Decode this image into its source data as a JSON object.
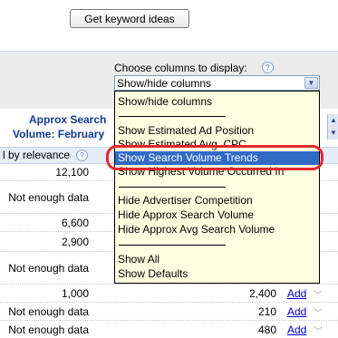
{
  "toolbar": {
    "get_ideas_label": "Get keyword ideas"
  },
  "columns_chooser": {
    "label": "Choose columns to display:",
    "help_icon": "?",
    "selected": "Show/hide columns",
    "arrow": "▼",
    "options": [
      "Show/hide columns",
      "Show Estimated Ad Position",
      "Show Estimated Avg. CPC",
      "Show Search Volume Trends",
      "Show Highest Volume Occurred In",
      "Hide Advertiser Competition",
      "Hide Approx Search Volume",
      "Hide Approx Avg Search Volume",
      "Show All",
      "Show Defaults"
    ],
    "highlighted_option": "Show Search Volume Trends"
  },
  "table": {
    "header_line1": "Approx Search",
    "header_line2": "Volume: February",
    "sort_label": "l by relevance",
    "sort_help": "?",
    "scroll_up": "▲",
    "scroll_down": "▼",
    "rows": [
      {
        "volume": "12,100",
        "volume2": "",
        "add": ""
      },
      {
        "volume": "Not enough data",
        "volume2": "",
        "add": ""
      },
      {
        "volume": "6,600",
        "volume2": "",
        "add": ""
      },
      {
        "volume": "2,900",
        "volume2": "",
        "add": ""
      },
      {
        "volume": "Not enough data",
        "volume2": "",
        "add": ""
      },
      {
        "volume": "1,000",
        "volume2": "2,400",
        "add": "Add"
      },
      {
        "volume": "Not enough data",
        "volume2": "210",
        "add": "Add"
      },
      {
        "volume": "Not enough data",
        "volume2": "480",
        "add": "Add"
      }
    ]
  },
  "colors": {
    "highlight_ring": "#e8262b",
    "dropdown_bg": "#ffffe1",
    "selection": "#316ac5",
    "header_text": "#123a8f"
  }
}
